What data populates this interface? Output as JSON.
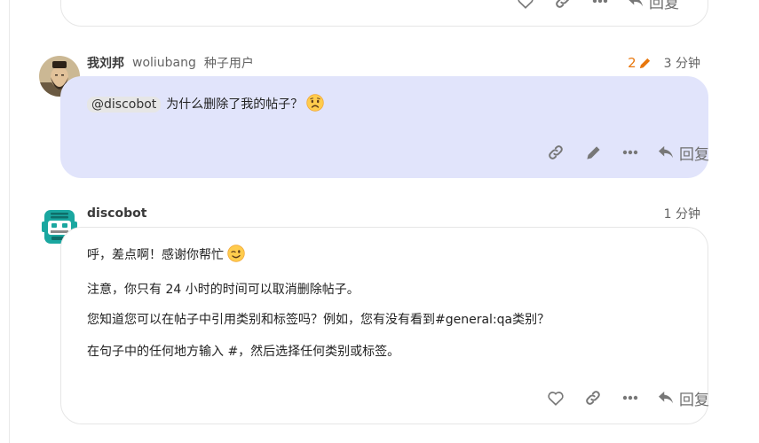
{
  "previous_post": {
    "actions": {
      "like": "like",
      "link": "copy-link",
      "more": "more",
      "reply_label": "回复"
    }
  },
  "post_user": {
    "name": "我刘邦",
    "username": "woliubang",
    "user_title": "种子用户",
    "edit_count": "2",
    "time": "3 分钟",
    "mention": "@discobot",
    "message": "为什么删除了我的帖子？",
    "emoji": "worried-face",
    "actions": {
      "link": "copy-link",
      "edit": "edit",
      "more": "more",
      "reply_label": "回复"
    }
  },
  "post_bot": {
    "name": "discobot",
    "time": "1 分钟",
    "lines": [
      "呼，差点啊！感谢你帮忙",
      "注意，你只有 24 小时的时间可以取消删除帖子。",
      "您知道您可以在帖子中引用类别和标签吗？例如，您有没有看到#general:qa类别？",
      "在句子中的任何地方输入 #，然后选择任何类别或标签。"
    ],
    "emoji": "winking-face",
    "actions": {
      "like": "like",
      "link": "copy-link",
      "more": "more",
      "reply_label": "回复"
    }
  },
  "colors": {
    "highlight_bg": "#e1e4fb",
    "edit_accent": "#e8770d",
    "bot_teal": "#1aa7a0"
  }
}
